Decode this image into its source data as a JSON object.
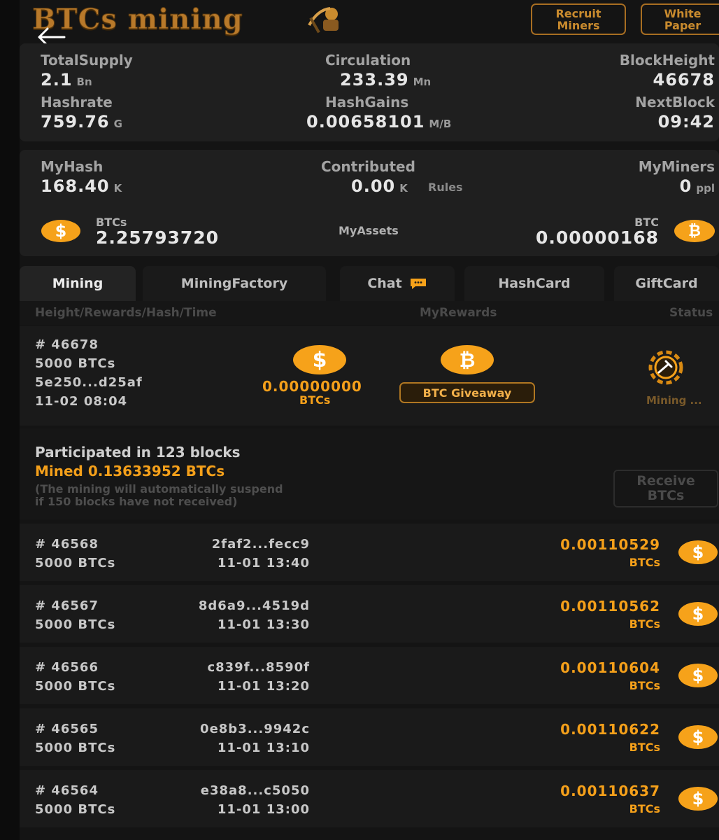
{
  "header": {
    "brand": "BTCs mining",
    "recruit_label": "Recruit\nMiners",
    "whitepaper_label": "White\nPaper"
  },
  "stats": {
    "total_supply": {
      "label": "TotalSupply",
      "value": "2.1",
      "unit": "Bn"
    },
    "circulation": {
      "label": "Circulation",
      "value": "233.39",
      "unit": "Mn"
    },
    "block_height": {
      "label": "BlockHeight",
      "value": "46678"
    },
    "hashrate": {
      "label": "Hashrate",
      "value": "759.76",
      "unit": "G"
    },
    "hash_gains": {
      "label": "HashGains",
      "value": "0.00658101",
      "unit": "M/B"
    },
    "next_block": {
      "label": "NextBlock",
      "value": "09:42"
    }
  },
  "my": {
    "my_hash": {
      "label": "MyHash",
      "value": "168.40",
      "unit": "K"
    },
    "contributed": {
      "label": "Contributed",
      "value": "0.00",
      "unit": "K",
      "rules": "Rules"
    },
    "my_miners": {
      "label": "MyMiners",
      "value": "0",
      "unit": "ppl"
    },
    "btcs": {
      "label": "BTCs",
      "value": "2.25793720"
    },
    "assets_label": "MyAssets",
    "btc": {
      "label": "BTC",
      "value": "0.00000168"
    }
  },
  "tabs": [
    "Mining",
    "MiningFactory",
    "Chat",
    "HashCard",
    "GiftCard"
  ],
  "columns": {
    "left": "Height/Rewards/Hash/Time",
    "mid": "MyRewards",
    "right": "Status"
  },
  "current": {
    "height": "# 46678",
    "rewards": "5000 BTCs",
    "hash": "5e250...d25af",
    "time": "11-02 08:04",
    "my_value": "0.00000000",
    "my_unit": "BTCs",
    "giveaway": "BTC Giveaway",
    "status": "Mining ..."
  },
  "summary": {
    "participated": "Participated in 123 blocks",
    "mined": "Mined 0.13633952 BTCs",
    "note1": "(The mining will automatically suspend",
    "note2": "if 150 blocks have not received)",
    "receive": "Receive\nBTCs"
  },
  "blocks": [
    {
      "height": "# 46568",
      "rewards": "5000 BTCs",
      "hash": "2faf2...fecc9",
      "time": "11-01 13:40",
      "amount": "0.00110529",
      "unit": "BTCs"
    },
    {
      "height": "# 46567",
      "rewards": "5000 BTCs",
      "hash": "8d6a9...4519d",
      "time": "11-01 13:30",
      "amount": "0.00110562",
      "unit": "BTCs"
    },
    {
      "height": "# 46566",
      "rewards": "5000 BTCs",
      "hash": "c839f...8590f",
      "time": "11-01 13:20",
      "amount": "0.00110604",
      "unit": "BTCs"
    },
    {
      "height": "# 46565",
      "rewards": "5000 BTCs",
      "hash": "0e8b3...9942c",
      "time": "11-01 13:10",
      "amount": "0.00110622",
      "unit": "BTCs"
    },
    {
      "height": "# 46564",
      "rewards": "5000 BTCs",
      "hash": "e38a8...c5050",
      "time": "11-01 13:00",
      "amount": "0.00110637",
      "unit": "BTCs"
    }
  ],
  "icons": {
    "dollar": "$",
    "bitcoin": "₿"
  },
  "colors": {
    "accent": "#f6a21a",
    "background": "#141414",
    "panel": "#1f1f1f"
  }
}
